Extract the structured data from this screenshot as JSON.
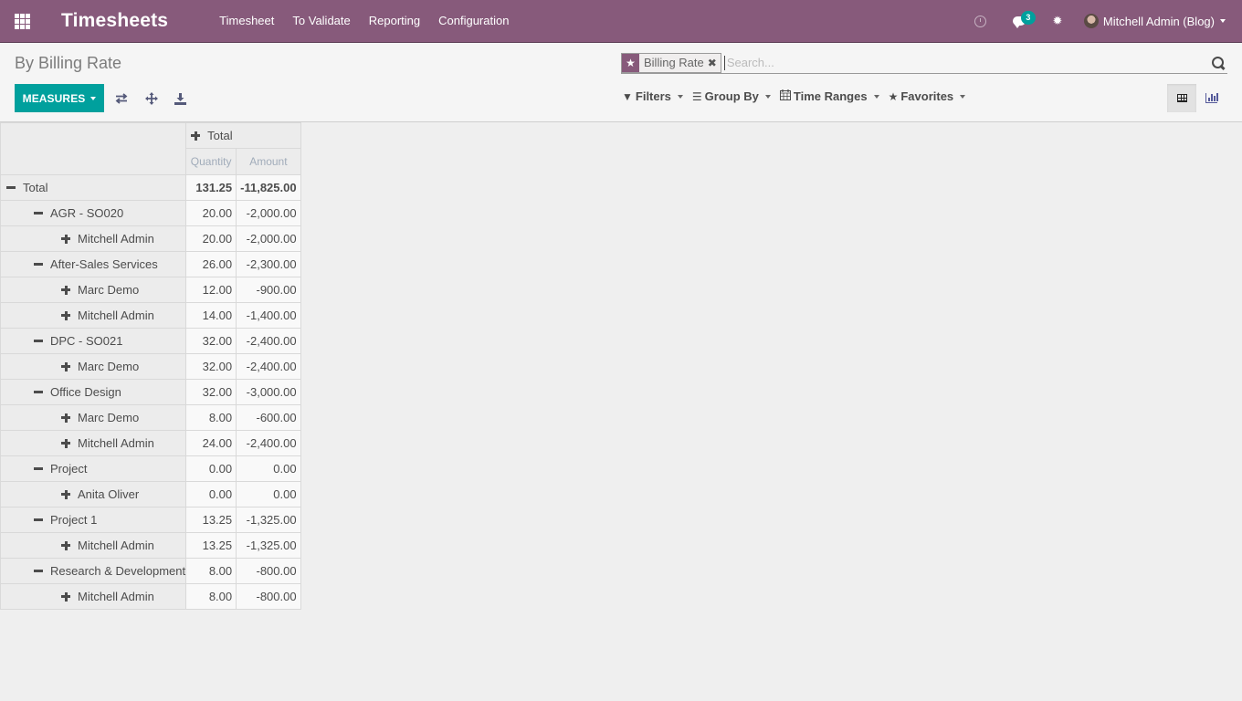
{
  "navbar": {
    "app_title": "Timesheets",
    "menu": [
      "Timesheet",
      "To Validate",
      "Reporting",
      "Configuration"
    ],
    "icons": [
      "apps-icon",
      "clock-icon",
      "chat-icon",
      "bug-icon"
    ],
    "messages_badge": "3",
    "user_name": "Mitchell Admin (Blog)"
  },
  "control_panel": {
    "breadcrumb": "By Billing Rate",
    "measures_label": "MEASURES",
    "tool_icons": [
      "flip-axis-icon",
      "expand-all-icon",
      "download-icon"
    ],
    "search": {
      "facet_value": "Billing Rate",
      "placeholder": "Search..."
    },
    "search_options": [
      "Filters",
      "Group By",
      "Time Ranges",
      "Favorites"
    ],
    "views": [
      {
        "name": "pivot",
        "active": true
      },
      {
        "name": "graph",
        "active": false
      }
    ]
  },
  "pivot": {
    "column_header": "Total",
    "measures": [
      "Quantity",
      "Amount"
    ],
    "rows": [
      {
        "label": "Total",
        "level": 0,
        "expanded": true,
        "quantity": "131.25",
        "amount": "-11,825.00"
      },
      {
        "label": "AGR - SO020",
        "level": 1,
        "expanded": true,
        "quantity": "20.00",
        "amount": "-2,000.00"
      },
      {
        "label": "Mitchell Admin",
        "level": 2,
        "expanded": false,
        "quantity": "20.00",
        "amount": "-2,000.00"
      },
      {
        "label": "After-Sales Services",
        "level": 1,
        "expanded": true,
        "quantity": "26.00",
        "amount": "-2,300.00"
      },
      {
        "label": "Marc Demo",
        "level": 2,
        "expanded": false,
        "quantity": "12.00",
        "amount": "-900.00"
      },
      {
        "label": "Mitchell Admin",
        "level": 2,
        "expanded": false,
        "quantity": "14.00",
        "amount": "-1,400.00"
      },
      {
        "label": "DPC - SO021",
        "level": 1,
        "expanded": true,
        "quantity": "32.00",
        "amount": "-2,400.00"
      },
      {
        "label": "Marc Demo",
        "level": 2,
        "expanded": false,
        "quantity": "32.00",
        "amount": "-2,400.00"
      },
      {
        "label": "Office Design",
        "level": 1,
        "expanded": true,
        "quantity": "32.00",
        "amount": "-3,000.00"
      },
      {
        "label": "Marc Demo",
        "level": 2,
        "expanded": false,
        "quantity": "8.00",
        "amount": "-600.00"
      },
      {
        "label": "Mitchell Admin",
        "level": 2,
        "expanded": false,
        "quantity": "24.00",
        "amount": "-2,400.00"
      },
      {
        "label": "Project",
        "level": 1,
        "expanded": true,
        "quantity": "0.00",
        "amount": "0.00"
      },
      {
        "label": "Anita Oliver",
        "level": 2,
        "expanded": false,
        "quantity": "0.00",
        "amount": "0.00"
      },
      {
        "label": "Project 1",
        "level": 1,
        "expanded": true,
        "quantity": "13.25",
        "amount": "-1,325.00"
      },
      {
        "label": "Mitchell Admin",
        "level": 2,
        "expanded": false,
        "quantity": "13.25",
        "amount": "-1,325.00"
      },
      {
        "label": "Research & Development",
        "level": 1,
        "expanded": true,
        "quantity": "8.00",
        "amount": "-800.00"
      },
      {
        "label": "Mitchell Admin",
        "level": 2,
        "expanded": false,
        "quantity": "8.00",
        "amount": "-800.00"
      }
    ]
  },
  "colors": {
    "brand": "#875a7b",
    "primary": "#00a09d"
  }
}
